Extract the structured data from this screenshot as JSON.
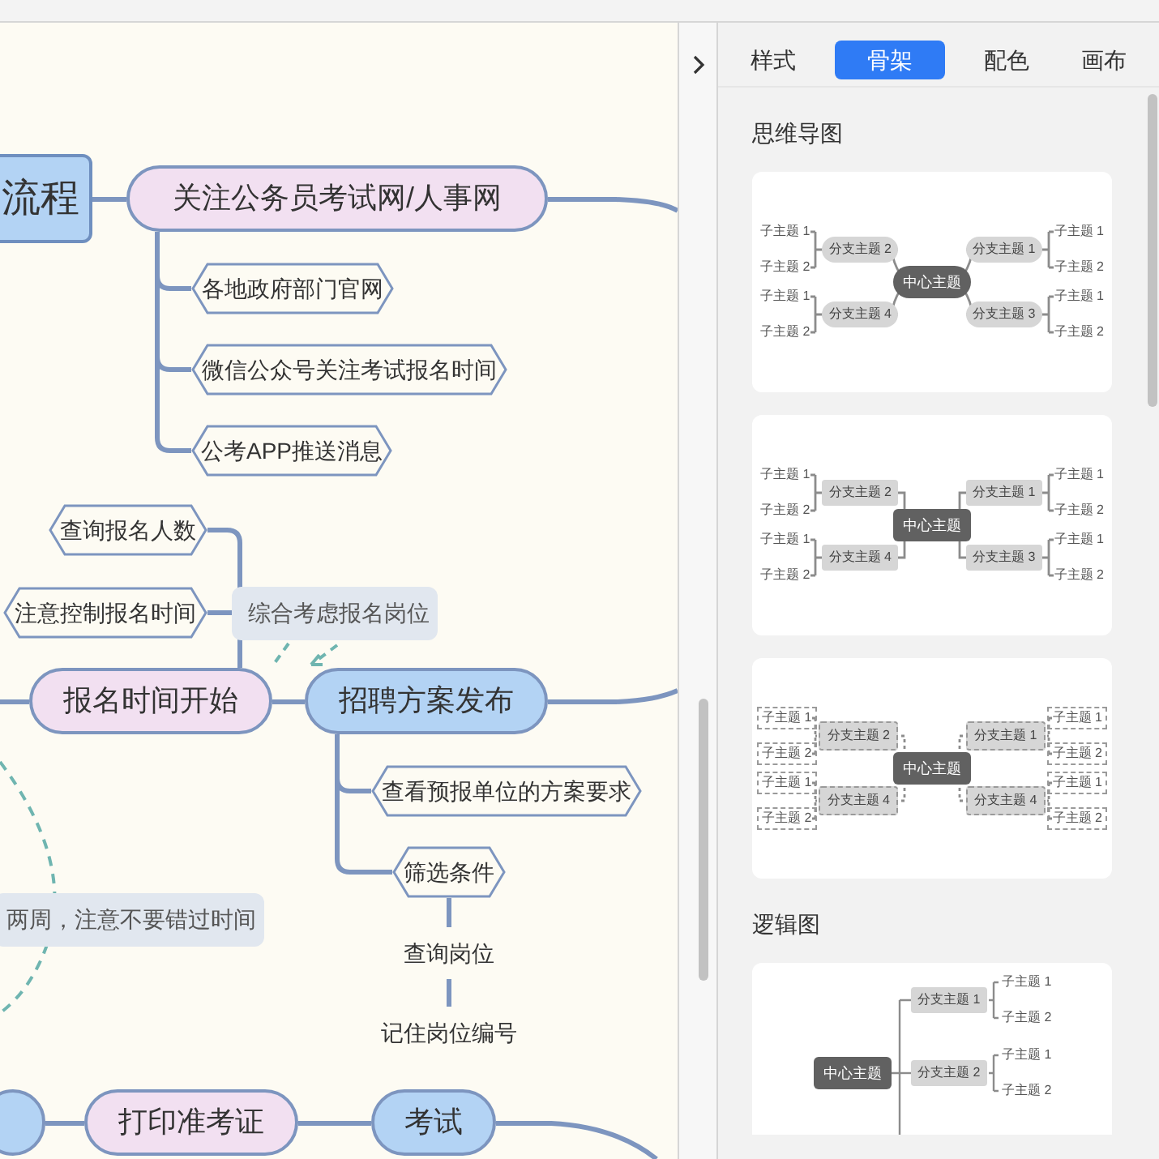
{
  "canvas": {
    "nodes": [
      {
        "kind": "root",
        "text": "流程",
        "color": "#b3d3f4"
      },
      {
        "kind": "pill",
        "text": "关注公务员考试网/人事网",
        "color": "#f2e0f1"
      },
      {
        "kind": "hex",
        "text": "各地政府部门官网"
      },
      {
        "kind": "hex",
        "text": "微信公众号关注考试报名时间"
      },
      {
        "kind": "hex",
        "text": "公考APP推送消息"
      },
      {
        "kind": "hex",
        "text": "查询报名人数"
      },
      {
        "kind": "hex",
        "text": "注意控制报名时间"
      },
      {
        "kind": "label",
        "text": "综合考虑报名岗位"
      },
      {
        "kind": "pill",
        "text": "报名时间开始",
        "color": "#f2e0f1"
      },
      {
        "kind": "pill",
        "text": "招聘方案发布",
        "color": "#b3d3f4"
      },
      {
        "kind": "hex",
        "text": "查看预报单位的方案要求"
      },
      {
        "kind": "hex",
        "text": "筛选条件"
      },
      {
        "kind": "plain",
        "text": "查询岗位"
      },
      {
        "kind": "plain",
        "text": "记住岗位编号"
      },
      {
        "kind": "label",
        "text": "两周，注意不要错过时间"
      },
      {
        "kind": "pill",
        "color": "#b3d3f4"
      },
      {
        "kind": "pill",
        "text": "打印准考证",
        "color": "#f2e0f1"
      },
      {
        "kind": "pill",
        "text": "考试",
        "color": "#b3d3f4"
      }
    ]
  },
  "panel": {
    "tabs": [
      {
        "label": "样式",
        "selected": false
      },
      {
        "label": "骨架",
        "selected": true
      },
      {
        "label": "配色",
        "selected": false
      },
      {
        "label": "画布",
        "selected": false
      }
    ],
    "sections": [
      {
        "title": "思维导图",
        "templates": [
          {
            "kind": "curved",
            "center": "中心主题",
            "branches": [
              {
                "label": "分支主题 2",
                "subtopics": [
                  "子主题 1",
                  "子主题 2"
                ]
              },
              {
                "label": "分支主题 1",
                "subtopics": [
                  "子主题 1",
                  "子主题 2"
                ]
              },
              {
                "label": "分支主题 4",
                "subtopics": [
                  "子主题 1",
                  "子主题 2"
                ]
              },
              {
                "label": "分支主题 3",
                "subtopics": [
                  "子主题 1",
                  "子主题 2"
                ]
              }
            ]
          },
          {
            "kind": "elbow",
            "center": "中心主题",
            "branches": [
              {
                "label": "分支主题 2",
                "subtopics": [
                  "子主题 1",
                  "子主题 2"
                ]
              },
              {
                "label": "分支主题 1",
                "subtopics": [
                  "子主题 1",
                  "子主题 2"
                ]
              },
              {
                "label": "分支主题 4",
                "subtopics": [
                  "子主题 1",
                  "子主题 2"
                ]
              },
              {
                "label": "分支主题 3",
                "subtopics": [
                  "子主题 1",
                  "子主题 2"
                ]
              }
            ]
          },
          {
            "kind": "dashed",
            "center": "中心主题",
            "branches": [
              {
                "label": "分支主题 2",
                "subtopics": [
                  "子主题 1",
                  "子主题 2"
                ]
              },
              {
                "label": "分支主题 1",
                "subtopics": [
                  "子主题 1",
                  "子主题 2"
                ]
              },
              {
                "label": "分支主题 4",
                "subtopics": [
                  "子主题 1",
                  "子主题 2"
                ]
              },
              {
                "label": "分支主题 4",
                "subtopics": [
                  "子主题 1",
                  "子主题 2"
                ]
              }
            ]
          }
        ]
      },
      {
        "title": "逻辑图",
        "templates": [
          {
            "kind": "logic",
            "center": "中心主题",
            "branches": [
              {
                "label": "分支主题 1",
                "subtopics": [
                  "子主题 1",
                  "子主题 2"
                ]
              },
              {
                "label": "分支主题 2",
                "subtopics": [
                  "子主题 1",
                  "子主题 2"
                ]
              }
            ]
          }
        ]
      }
    ]
  }
}
